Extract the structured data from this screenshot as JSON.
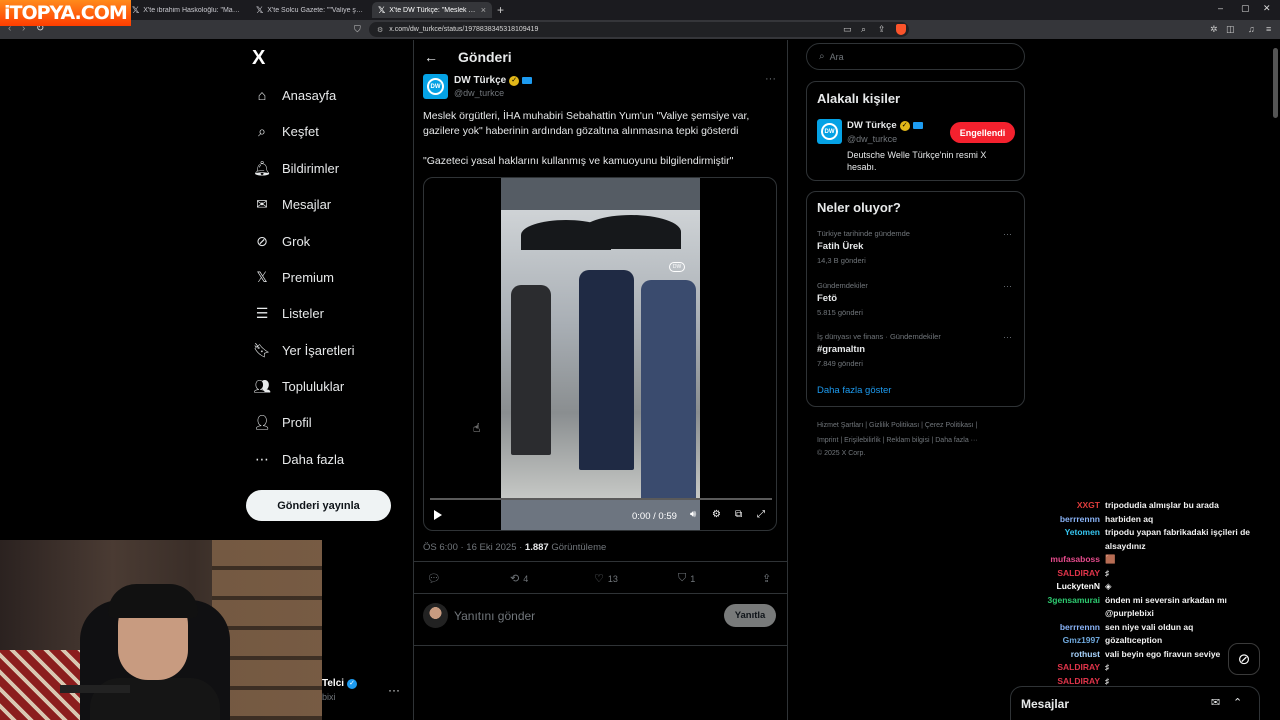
{
  "watermark": {
    "text": "iTOPYA.COM"
  },
  "browser": {
    "tabs": [
      {
        "title": "X'te ibrahim Haskoloğlu: \"Mango, kış...",
        "active": false
      },
      {
        "title": "X'te Solcu Gazete: \"\"Valiye şemsiye var...",
        "active": false
      },
      {
        "title": "X'te DW Türkçe: \"Meslek örgütle...",
        "active": true
      }
    ],
    "url": "x.com/dw_turkce/status/1978838345318109419",
    "new_tab": "+",
    "window_controls": [
      "–",
      "▢",
      "✕"
    ]
  },
  "nav": {
    "logo": "X",
    "items": [
      {
        "label": "Anasayfa",
        "icon": "home-icon",
        "glyph": "⌂"
      },
      {
        "label": "Keşfet",
        "icon": "search-icon",
        "glyph": "⌕"
      },
      {
        "label": "Bildirimler",
        "icon": "bell-icon",
        "glyph": "🔔︎"
      },
      {
        "label": "Mesajlar",
        "icon": "mail-icon",
        "glyph": "✉"
      },
      {
        "label": "Grok",
        "icon": "grok-icon",
        "glyph": "⊘"
      },
      {
        "label": "Premium",
        "icon": "x-premium-icon",
        "glyph": "𝕏"
      },
      {
        "label": "Listeler",
        "icon": "list-icon",
        "glyph": "☰"
      },
      {
        "label": "Yer İşaretleri",
        "icon": "bookmark-icon",
        "glyph": "🔖︎"
      },
      {
        "label": "Topluluklar",
        "icon": "communities-icon",
        "glyph": "👥︎"
      },
      {
        "label": "Profil",
        "icon": "profile-icon",
        "glyph": "👤︎"
      },
      {
        "label": "Daha fazla",
        "icon": "more-circle-icon",
        "glyph": "⋯"
      }
    ],
    "post_button": "Gönderi yayınla",
    "account": {
      "name": "Telci",
      "handle": "bixi"
    }
  },
  "post": {
    "header_title": "Gönderi",
    "author": {
      "name": "DW Türkçe",
      "handle": "@dw_turkce",
      "avatar_text": "DW"
    },
    "text": "Meslek örgütleri, İHA muhabiri Sebahattin Yum'un \"Valiye şemsiye var, gazilere yok\" haberinin ardından gözaltına alınmasına tepki gösterdi",
    "quote": "\"Gazeteci yasal haklarını kullanmış ve kamuoyunu bilgilendirmiştir\"",
    "video": {
      "time": "0:00 / 0:59",
      "watermark": "DW"
    },
    "timestamp": "ÖS 6:00 · 16 Eki 2025 · ",
    "views": "1.887",
    "views_label": " Görüntüleme",
    "actions": {
      "replies": "",
      "reposts": "4",
      "likes": "13",
      "bookmarks": "1"
    },
    "reply_placeholder": "Yanıtını gönder",
    "reply_button": "Yanıtla"
  },
  "sidebar": {
    "search_placeholder": "Ara",
    "related": {
      "title": "Alakalı kişiler",
      "name": "DW Türkçe",
      "handle": "@dw_turkce",
      "bio": "Deutsche Welle Türkçe'nin resmi X hesabı.",
      "button": "Engellendi"
    },
    "trends": {
      "title": "Neler oluyor?",
      "items": [
        {
          "context": "Türkiye tarihinde gündemde",
          "name": "Fatih Ürek",
          "count": "14,3 B gönderi"
        },
        {
          "context": "Gündemdekiler",
          "name": "Fetö",
          "count": "5.815 gönderi"
        },
        {
          "context": "İş dünyası ve finans · Gündemdekiler",
          "name": "#gramaltın",
          "count": "7.849 gönderi"
        }
      ],
      "show_more": "Daha fazla göster"
    },
    "footer": {
      "line1": "Hizmet Şartları  |  Gizlilik Politikası  |  Çerez Politikası  |",
      "line2": "Imprint  |  Erişilebilirlik  |  Reklam bilgisi  |  Daha fazla ···",
      "line3": "© 2025 X Corp."
    }
  },
  "chat": {
    "lines": [
      {
        "user": "XXGT",
        "color": "#e03c3c",
        "msg": "tripodudia almışlar bu arada"
      },
      {
        "user": "berrrennn",
        "color": "#8ab4f8",
        "msg": "harbiden aq"
      },
      {
        "user": "Yetomen",
        "color": "#36c5f0",
        "msg": "tripodu yapan fabrikadaki işçileri de alsaydınız"
      },
      {
        "user": "mufasaboss",
        "color": "#e54b8c",
        "msg": "🟫"
      },
      {
        "user": "SALDIRAY",
        "color": "#e0344a",
        "msg": "♯"
      },
      {
        "user": "LuckytenN",
        "color": "#ffffff",
        "msg": "◈"
      },
      {
        "user": "3gensamurai",
        "color": "#2ecc71",
        "msg": "önden mi seversin arkadan mı @purplebixi"
      },
      {
        "user": "berrrennn",
        "color": "#8ab4f8",
        "msg": "sen niye vali oldun aq"
      },
      {
        "user": "Gmz1997",
        "color": "#6fa8dc",
        "msg": "gözaltıception"
      },
      {
        "user": "rothust",
        "color": "#a9d5ff",
        "msg": "vali beyin ego firavun seviye"
      },
      {
        "user": "SALDIRAY",
        "color": "#e0344a",
        "msg": "♯"
      },
      {
        "user": "SALDIRAY",
        "color": "#e0344a",
        "msg": "♯"
      }
    ]
  },
  "dock": {
    "title": "Mesajlar"
  }
}
